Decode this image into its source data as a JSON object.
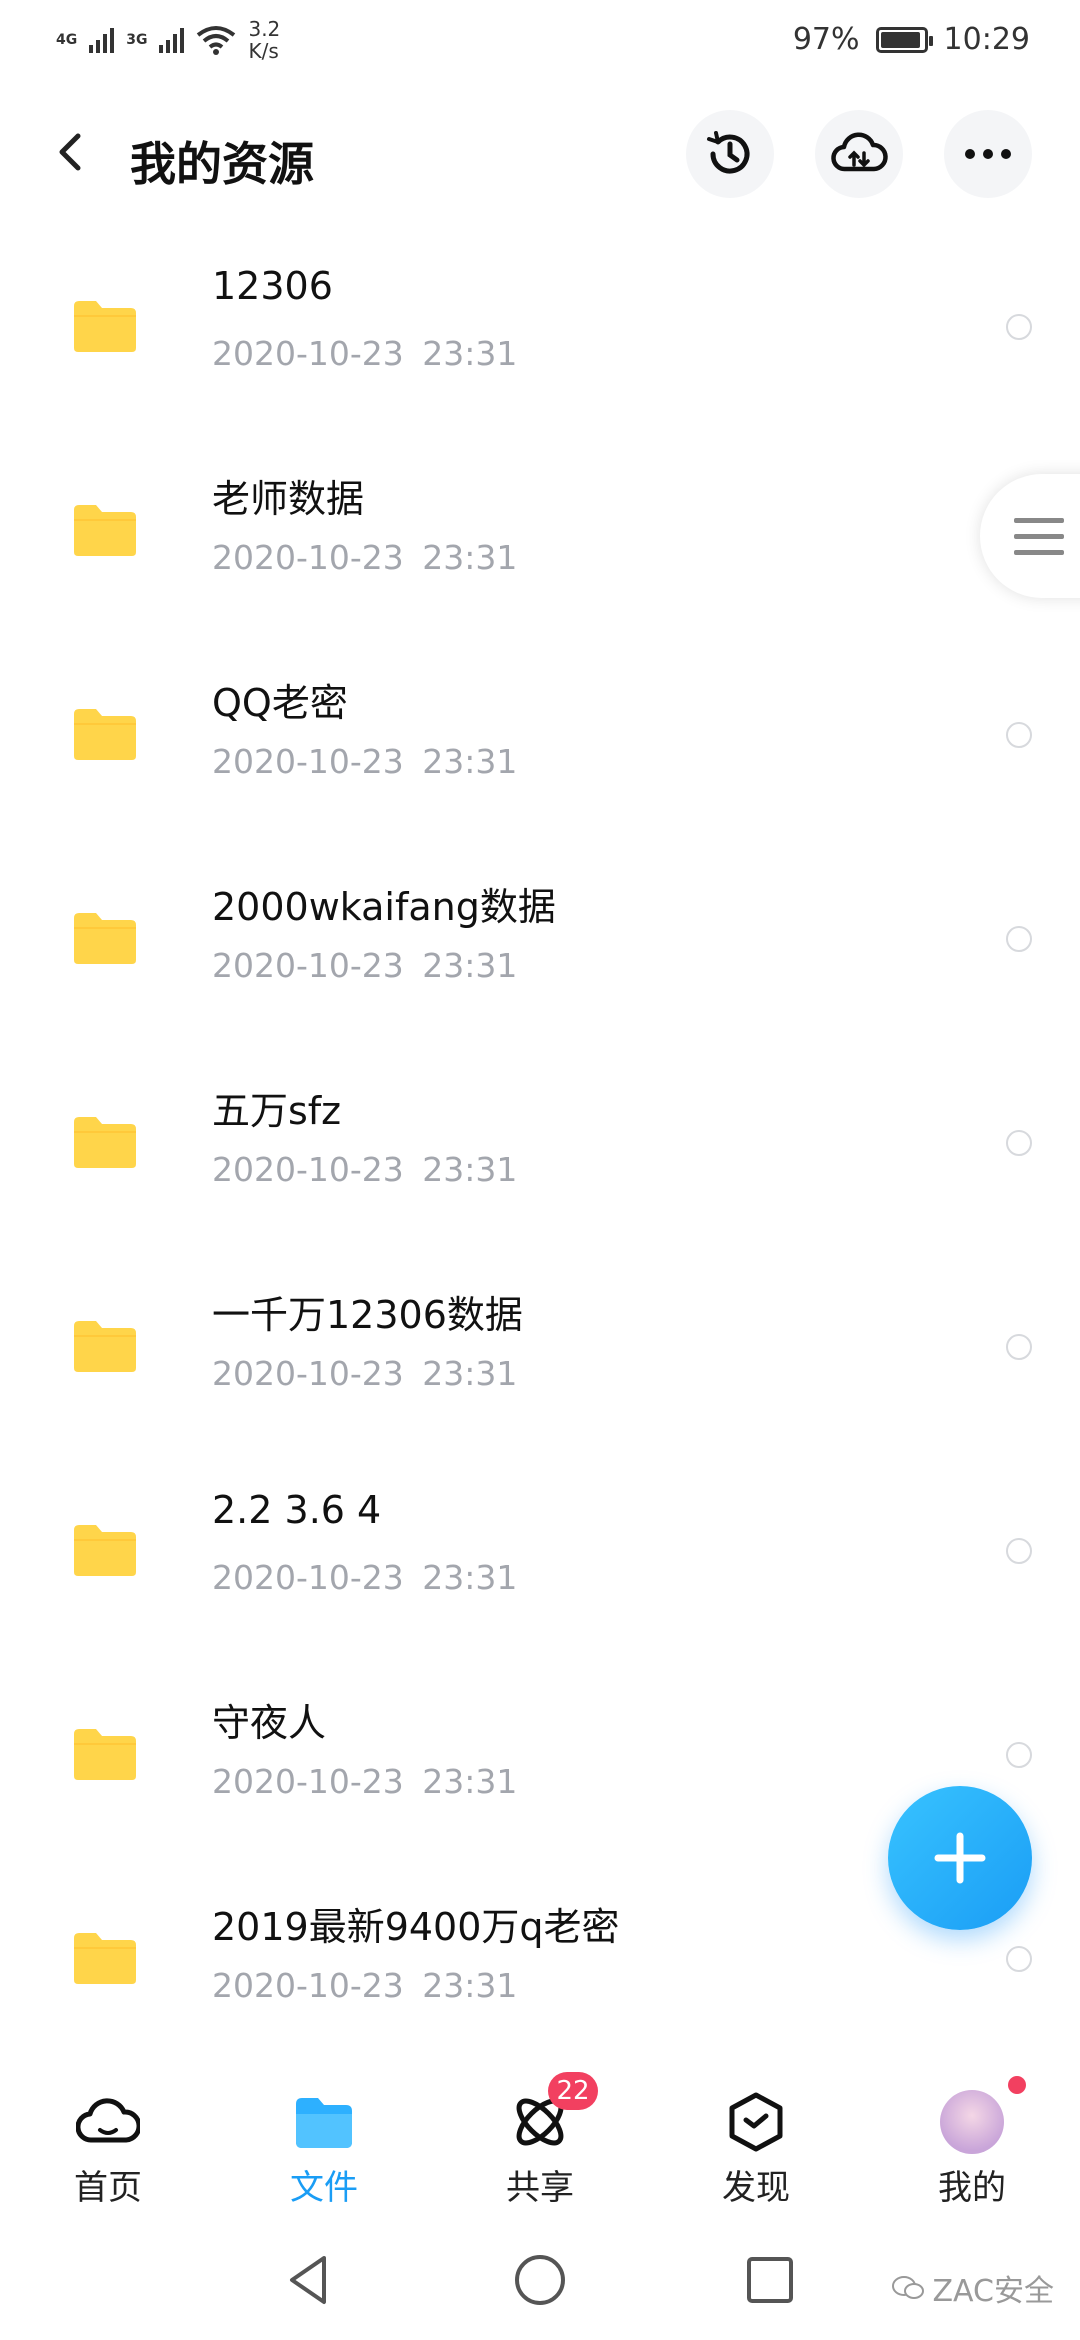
{
  "status_bar": {
    "network1": "4G",
    "network2": "3G",
    "speed": "3.2 K/s",
    "battery_percent": 97,
    "battery_label": "97%",
    "time": "10:29"
  },
  "header": {
    "title": "我的资源",
    "back_icon": "chevron-left-icon",
    "actions": [
      "history-icon",
      "cloud-transfer-icon",
      "more-icon"
    ]
  },
  "files": [
    {
      "name": "12306",
      "date": "2020-10-23 23:31"
    },
    {
      "name": "老师数据",
      "date": "2020-10-23 23:31"
    },
    {
      "name": "QQ老密",
      "date": "2020-10-23 23:31"
    },
    {
      "name": "2000wkaifang数据",
      "date": "2020-10-23 23:31"
    },
    {
      "name": "五万sfz",
      "date": "2020-10-23 23:31"
    },
    {
      "name": "一千万12306数据",
      "date": "2020-10-23 23:31"
    },
    {
      "name": "2.2 3.6 4",
      "date": "2020-10-23 23:31"
    },
    {
      "name": "守夜人",
      "date": "2020-10-23 23:31"
    },
    {
      "name": "2019最新9400万q老密",
      "date": "2020-10-23 23:31"
    }
  ],
  "bottom_nav": {
    "items": [
      {
        "label": "首页",
        "icon": "cloud-home-icon"
      },
      {
        "label": "文件",
        "icon": "folder-icon",
        "active": true
      },
      {
        "label": "共享",
        "icon": "share-orbit-icon",
        "badge": "22"
      },
      {
        "label": "发现",
        "icon": "discover-box-icon"
      },
      {
        "label": "我的",
        "icon": "avatar-icon",
        "dot": true
      }
    ]
  },
  "watermark": "ZAC安全",
  "colors": {
    "accent": "#1a9df5",
    "folder": "#ffd54a",
    "badge": "#f24060",
    "date_text": "#a3a6ad"
  }
}
